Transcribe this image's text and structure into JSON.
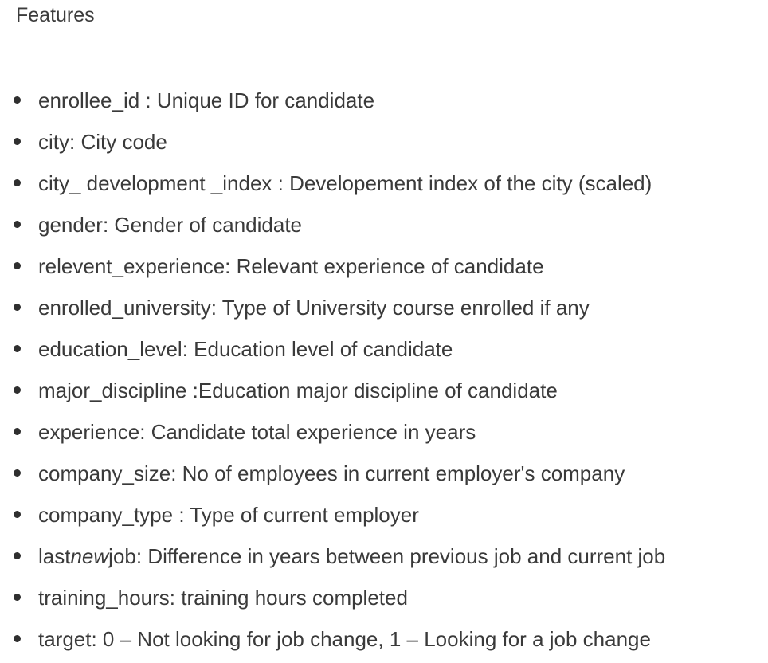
{
  "heading": "Features",
  "features": [
    {
      "text": "enrollee_id : Unique ID for candidate"
    },
    {
      "text": "city: City code"
    },
    {
      "text": "city_ development _index : Developement index of the city (scaled)"
    },
    {
      "text": "gender: Gender of candidate"
    },
    {
      "text": "relevent_experience: Relevant experience of candidate"
    },
    {
      "text": "enrolled_university: Type of University course enrolled if any"
    },
    {
      "text": "education_level: Education level of candidate"
    },
    {
      "text": "major_discipline :Education major discipline of candidate"
    },
    {
      "text": "experience: Candidate total experience in years"
    },
    {
      "text": "company_size: No of employees in current employer's company"
    },
    {
      "text": "company_type : Type of current employer"
    },
    {
      "pre": "last",
      "em": "new",
      "post": "job: Difference in years between previous job and current job"
    },
    {
      "text": "training_hours: training hours completed"
    },
    {
      "text": "target: 0 – Not looking for job change, 1 – Looking for a job change"
    }
  ]
}
